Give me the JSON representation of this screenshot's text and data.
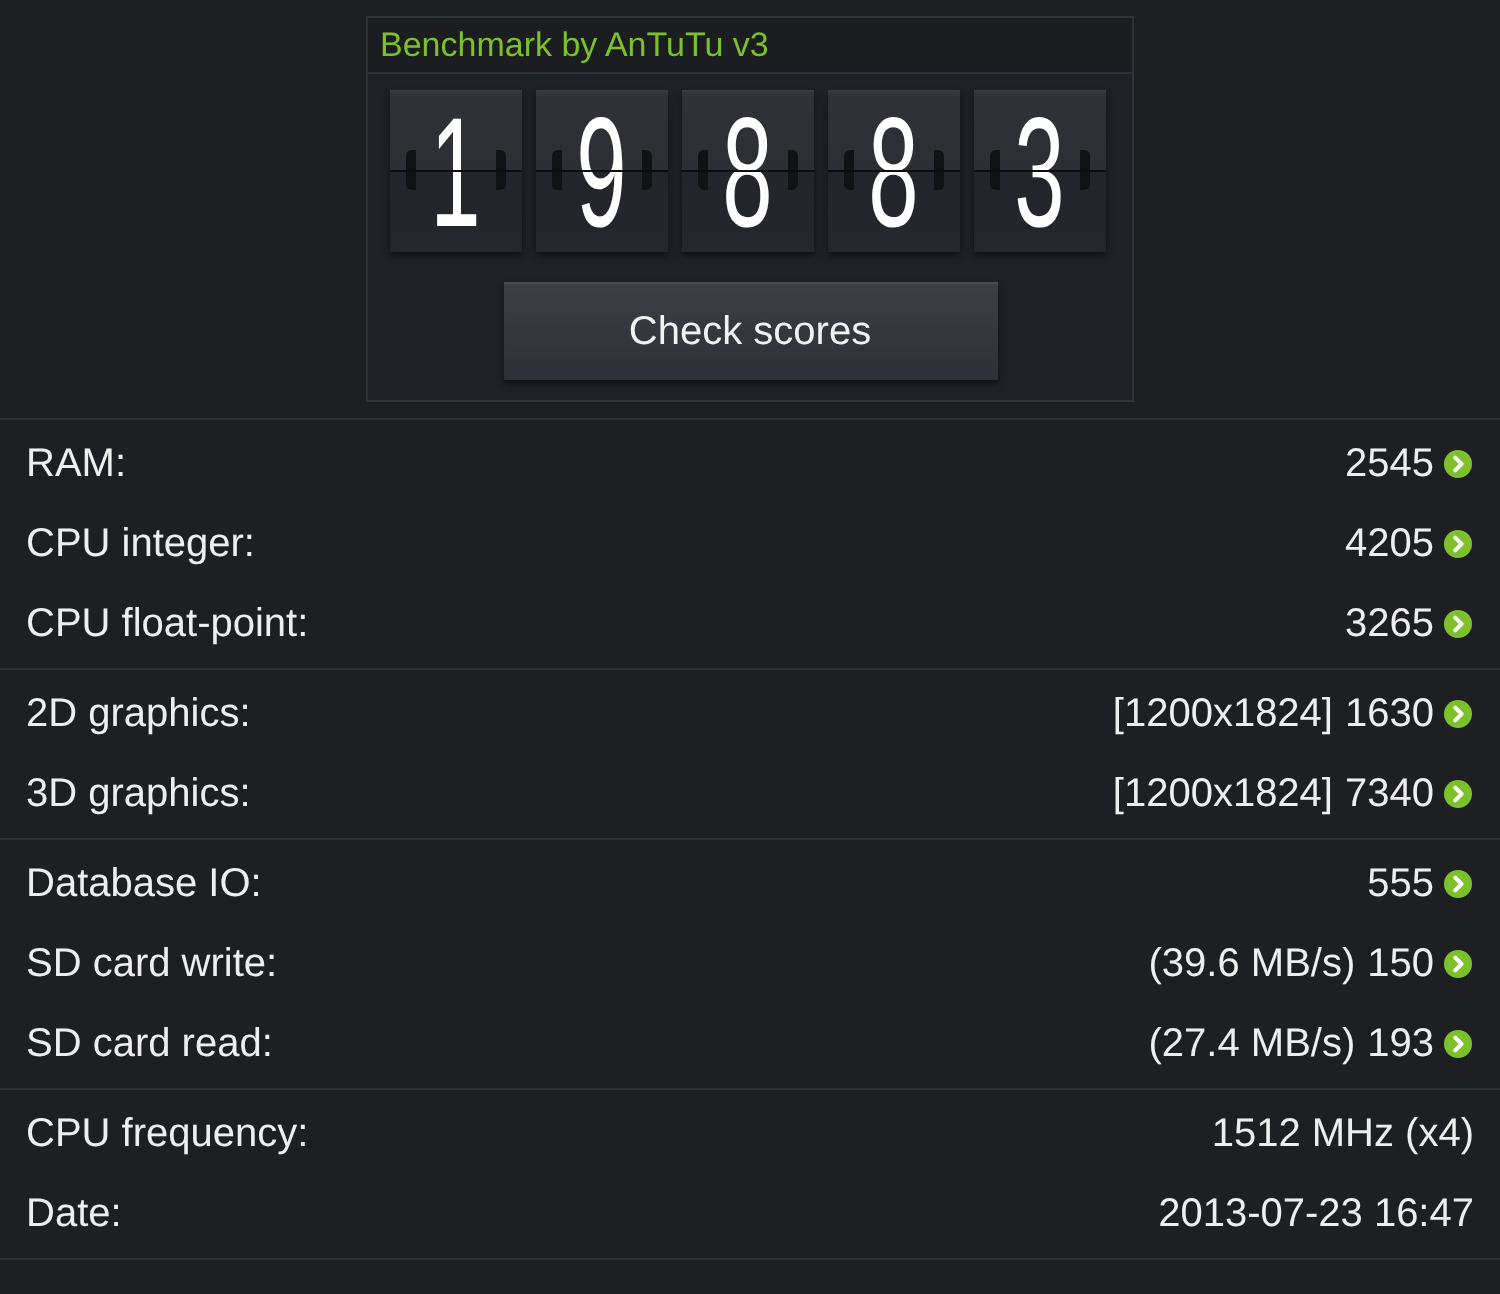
{
  "header": {
    "title": "Benchmark by AnTuTu v3"
  },
  "score": {
    "digits": [
      "1",
      "9",
      "8",
      "8",
      "3"
    ]
  },
  "button": {
    "label": "Check scores"
  },
  "sections": [
    {
      "rows": [
        {
          "kind": "score",
          "label": "RAM:",
          "value": "2545"
        },
        {
          "kind": "score",
          "label": "CPU integer:",
          "value": "4205"
        },
        {
          "kind": "score",
          "label": "CPU float-point:",
          "value": "3265"
        }
      ]
    },
    {
      "rows": [
        {
          "kind": "score",
          "label": "2D graphics:",
          "detail": "[1200x1824]",
          "value": "1630"
        },
        {
          "kind": "score",
          "label": "3D graphics:",
          "detail": "[1200x1824]",
          "value": "7340"
        }
      ]
    },
    {
      "rows": [
        {
          "kind": "score",
          "label": "Database IO:",
          "value": "555"
        },
        {
          "kind": "score",
          "label": "SD card write:",
          "detail": "(39.6 MB/s)",
          "value": "150"
        },
        {
          "kind": "score",
          "label": "SD card read:",
          "detail": "(27.4 MB/s)",
          "value": "193"
        }
      ]
    },
    {
      "rows": [
        {
          "kind": "info",
          "label": "CPU frequency:",
          "value": "1512 MHz (x4)"
        },
        {
          "kind": "info",
          "label": "Date:",
          "value": "2013-07-23 16:47"
        }
      ]
    }
  ]
}
